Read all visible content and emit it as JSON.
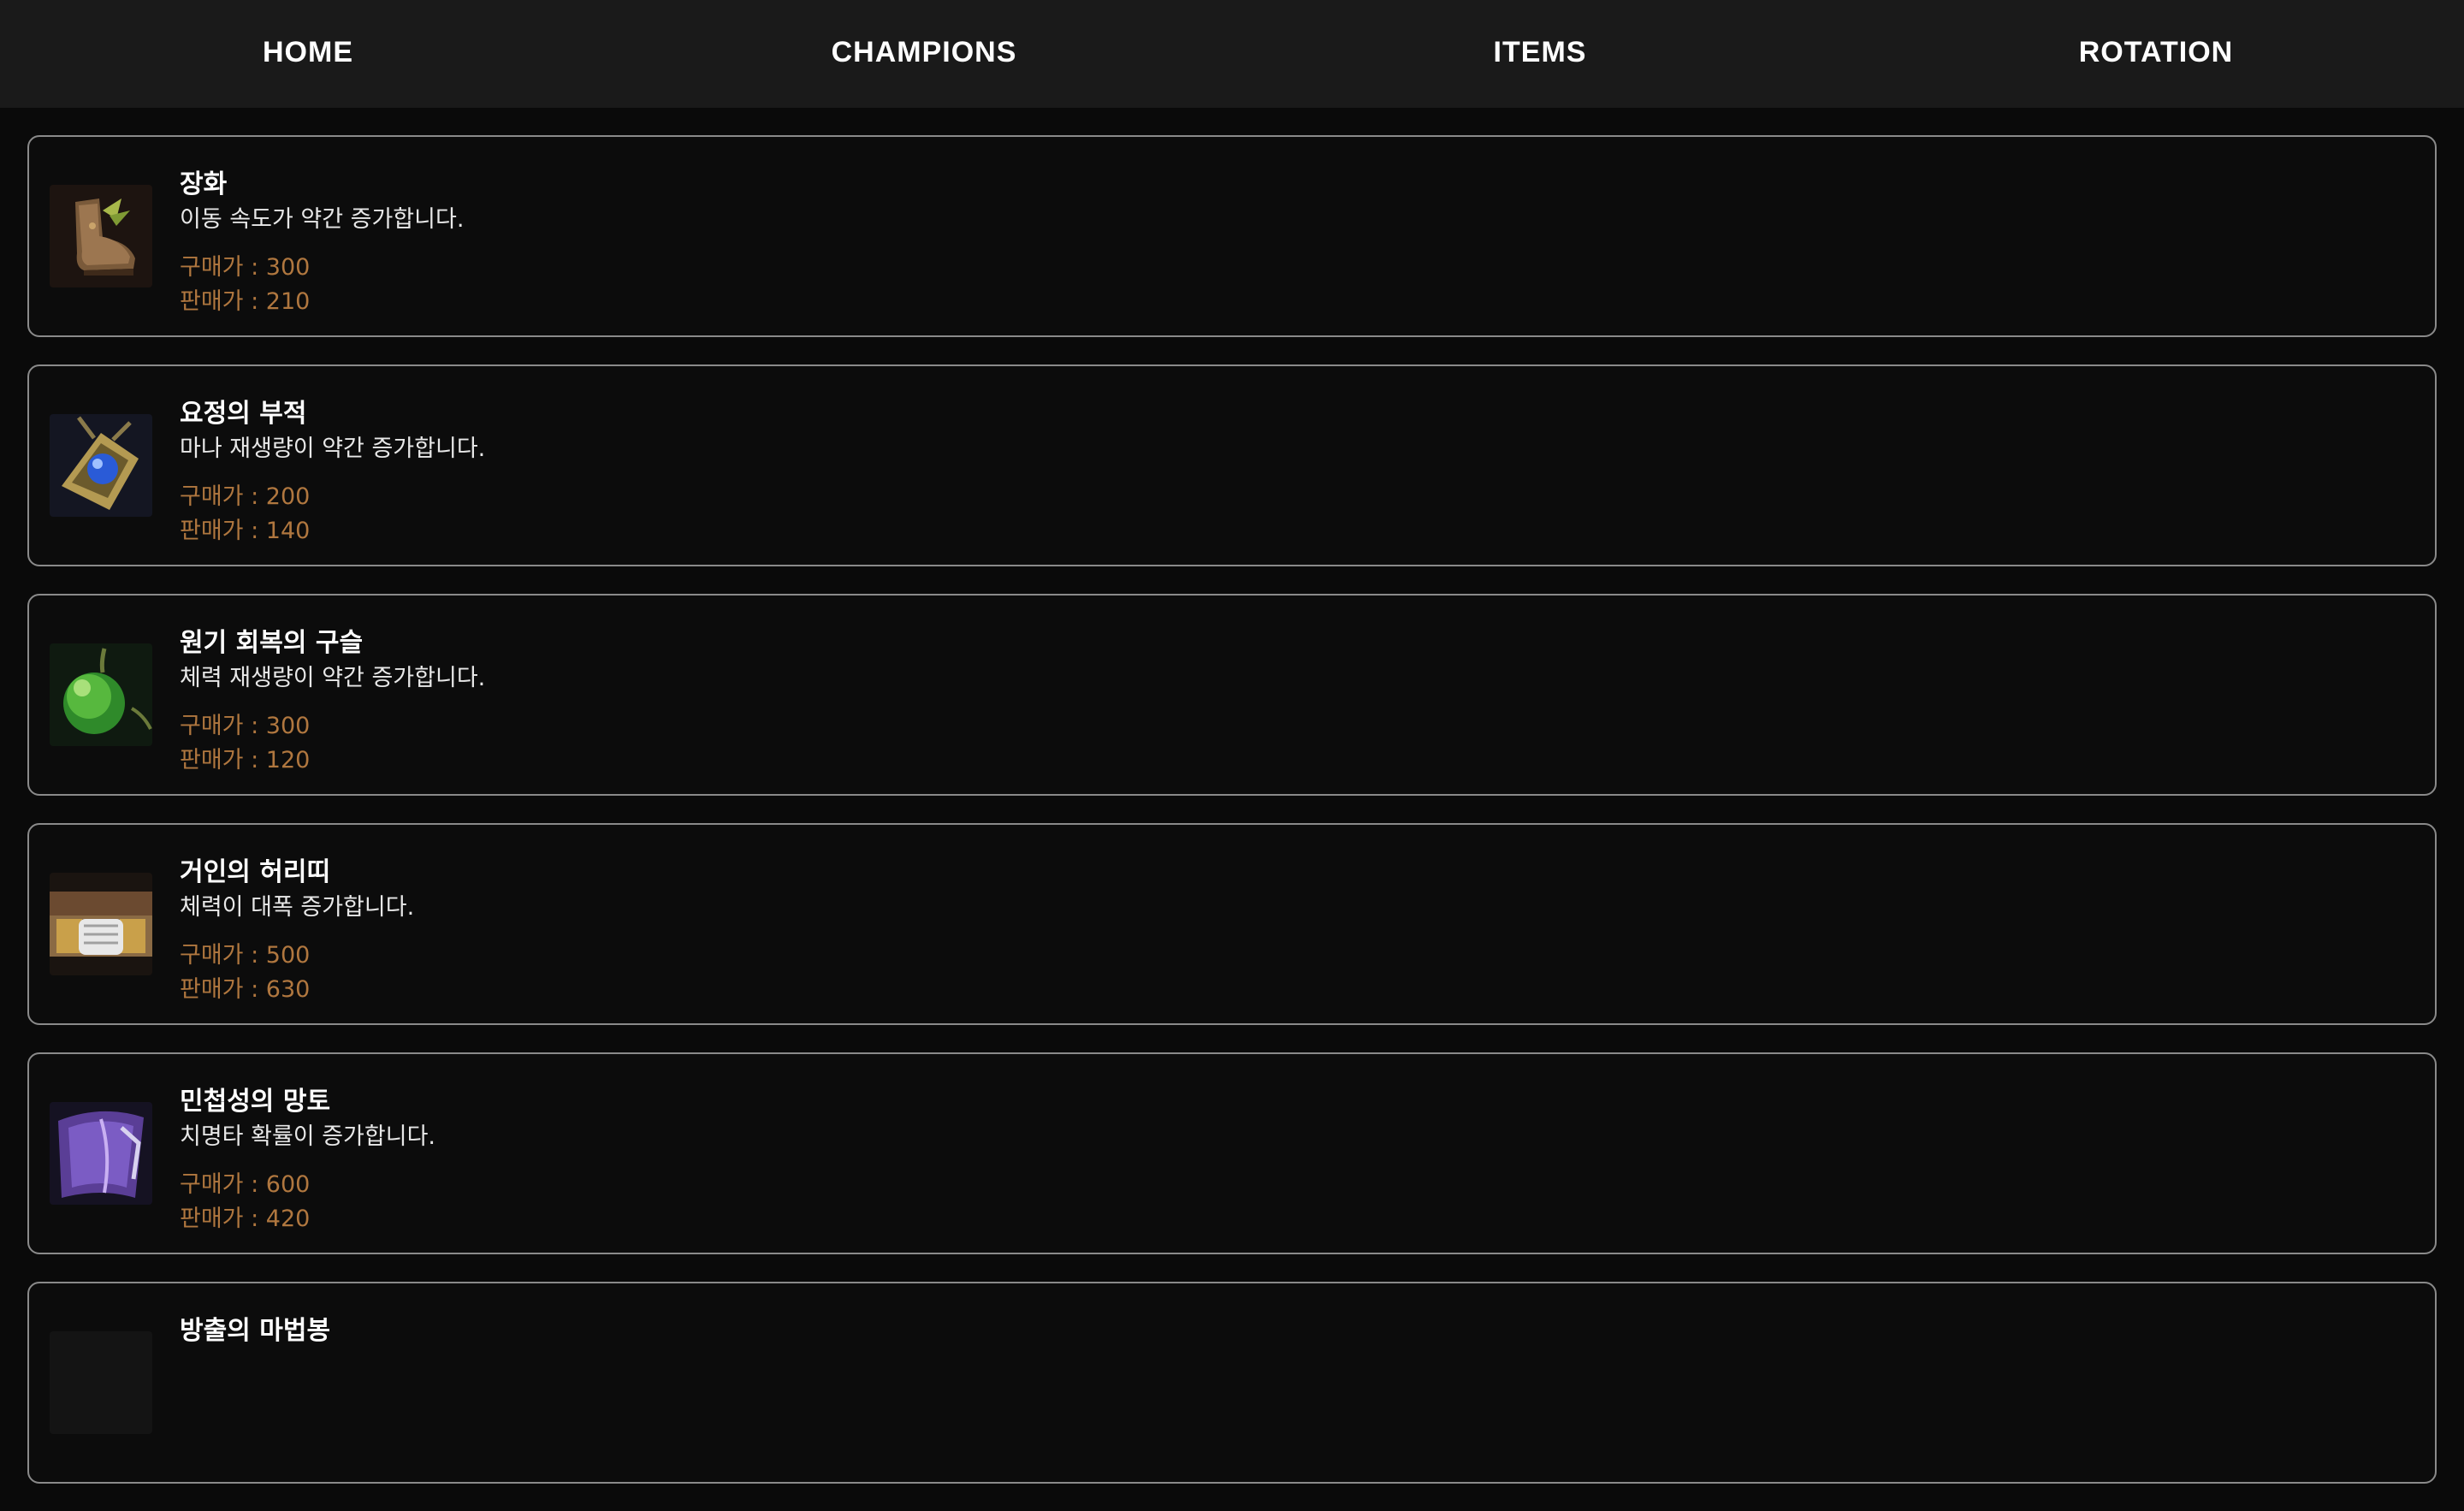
{
  "nav": {
    "items": [
      "HOME",
      "CHAMPIONS",
      "ITEMS",
      "ROTATION"
    ]
  },
  "colors": {
    "background": "#0a0a0a",
    "nav_background": "#1a1a1a",
    "card_border": "#8a8a8a",
    "price_text": "#b0773f"
  },
  "items": [
    {
      "name": "장화",
      "description": "이동 속도가 약간 증가합니다.",
      "buy": "구매가 : 300",
      "sell": "판매가 : 210",
      "icon": "boots-icon"
    },
    {
      "name": "요정의 부적",
      "description": "마나 재생량이 약간 증가합니다.",
      "buy": "구매가 : 200",
      "sell": "판매가 : 140",
      "icon": "amulet-icon"
    },
    {
      "name": "원기 회복의 구슬",
      "description": "체력 재생량이 약간 증가합니다.",
      "buy": "구매가 : 300",
      "sell": "판매가 : 120",
      "icon": "green-orb-icon"
    },
    {
      "name": "거인의 허리띠",
      "description": "체력이 대폭 증가합니다.",
      "buy": "구매가 : 500",
      "sell": "판매가 : 630",
      "icon": "belt-icon"
    },
    {
      "name": "민첩성의 망토",
      "description": "치명타 확률이 증가합니다.",
      "buy": "구매가 : 600",
      "sell": "판매가 : 420",
      "icon": "cloak-icon"
    },
    {
      "name": "방출의 마법봉",
      "description": "",
      "buy": "",
      "sell": "",
      "icon": "wand-icon"
    }
  ]
}
